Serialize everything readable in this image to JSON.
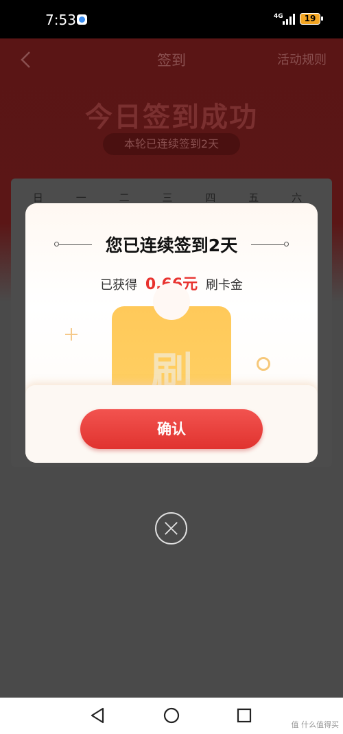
{
  "status_bar": {
    "time": "7:53",
    "network": "4G",
    "battery": "19"
  },
  "nav": {
    "title": "签到",
    "rules": "活动规则"
  },
  "hero": {
    "title": "今日签到成功",
    "subtitle": "本轮已连续签到2天"
  },
  "calendar": {
    "weekdays": [
      "日",
      "一",
      "二",
      "三",
      "四",
      "五",
      "六"
    ]
  },
  "modal": {
    "title": "您已连续签到2天",
    "reward_prefix": "已获得",
    "reward_amount": "0.66元",
    "reward_suffix": "刷卡金",
    "card_glyph": "刷",
    "confirm": "确认"
  },
  "watermark": "值 什么值得买",
  "colors": {
    "accent": "#e8332f",
    "card": "#ffc95a",
    "overlay": "#4a4a4a"
  }
}
